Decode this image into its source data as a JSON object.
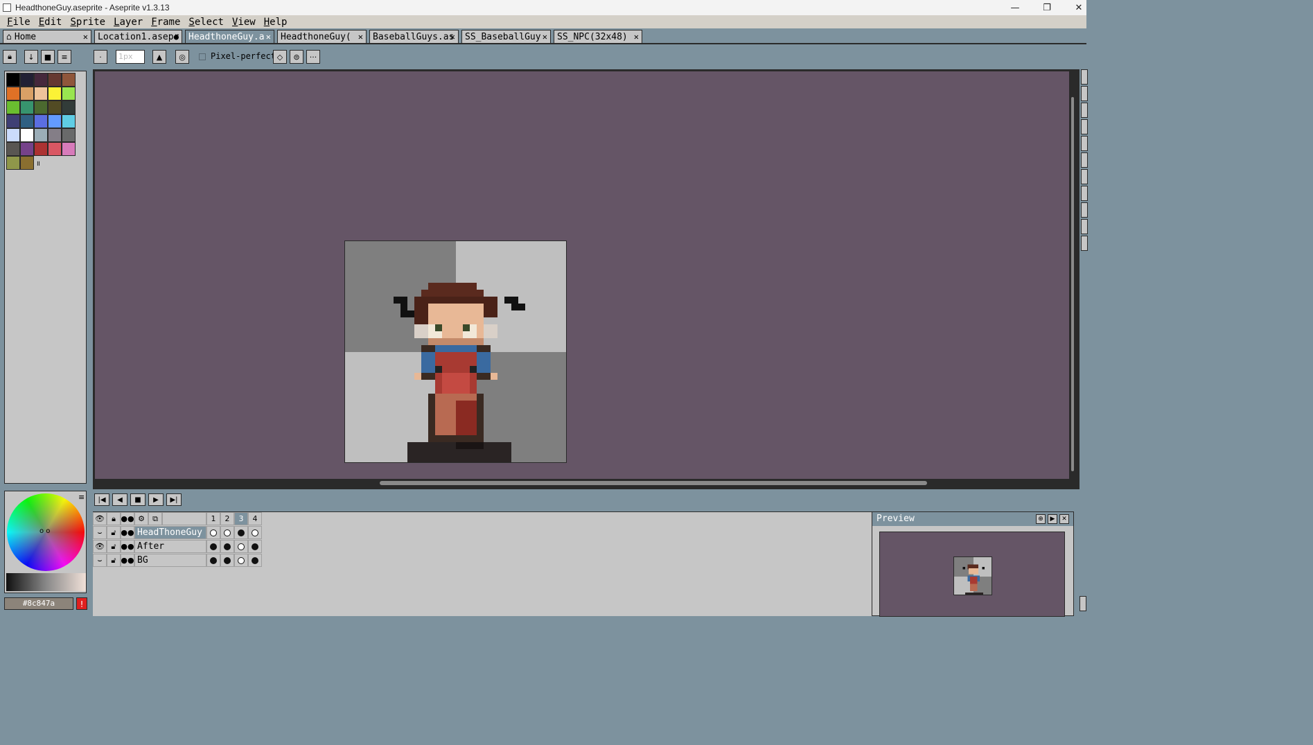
{
  "window": {
    "title": "HeadthoneGuy.aseprite - Aseprite v1.3.13",
    "minimize_icon": "minimize-icon",
    "maximize_icon": "restore-icon",
    "close_icon": "close-icon"
  },
  "menu": [
    "File",
    "Edit",
    "Sprite",
    "Layer",
    "Frame",
    "Select",
    "View",
    "Help"
  ],
  "tabs": [
    {
      "label": "Home",
      "icon": "home-icon",
      "close": "✕"
    },
    {
      "label": "Location1.asepr",
      "modified": "●"
    },
    {
      "label": "HeadthoneGuy.a",
      "close": "✕",
      "active": true
    },
    {
      "label": "HeadthoneGuy(",
      "close": "✕"
    },
    {
      "label": "BaseballGuys.as",
      "close": "✕"
    },
    {
      "label": "SS_BaseballGuy",
      "close": "✕"
    },
    {
      "label": "SS_NPC(32x48)",
      "close": "✕"
    }
  ],
  "toolbar": {
    "brush_size_placeholder": "1px",
    "pixel_perfect_label": "Pixel-perfect",
    "more_label": "···"
  },
  "palette": {
    "colors": [
      "#000000",
      "#222034",
      "#45283c",
      "#663931",
      "#8f563b",
      "#df7126",
      "#d9a066",
      "#eec39a",
      "#fbf236",
      "#99e550",
      "#6abe30",
      "#37946e",
      "#4b692f",
      "#524b24",
      "#323c39",
      "#3f3f74",
      "#306082",
      "#5b6ee1",
      "#639bff",
      "#5fcde4",
      "#cbdbfc",
      "#ffffff",
      "#9badb7",
      "#847e87",
      "#696a6a",
      "#595652",
      "#76428a",
      "#ac3232",
      "#d95763",
      "#d77bba",
      "#8f974a",
      "#8a6f30"
    ],
    "more_icon": "pause-icon"
  },
  "color": {
    "hex": "#8c847a",
    "warning": "!"
  },
  "timeline": {
    "controls": [
      "first-frame-icon",
      "prev-frame-icon",
      "play-icon",
      "next-frame-icon",
      "last-frame-icon"
    ],
    "frames": [
      "1",
      "2",
      "3",
      "4"
    ],
    "layers": [
      {
        "name": "HeadThoneGuy",
        "visible": false,
        "cels": [
          "empty",
          "empty",
          "filled",
          "empty"
        ]
      },
      {
        "name": "After",
        "visible": true,
        "cels": [
          "filled",
          "filled",
          "empty",
          "filled"
        ]
      },
      {
        "name": "BG",
        "visible": false,
        "cels": [
          "filled",
          "filled",
          "empty",
          "filled"
        ]
      }
    ]
  },
  "preview": {
    "title": "Preview"
  }
}
